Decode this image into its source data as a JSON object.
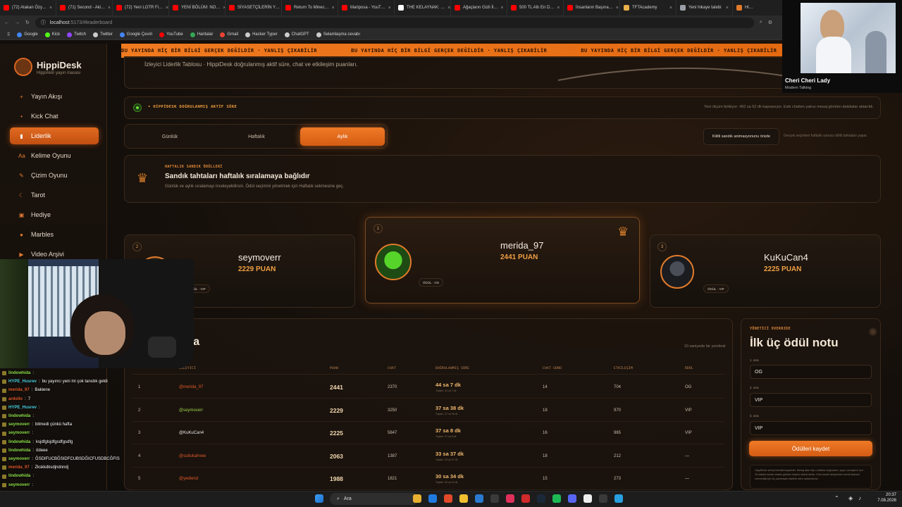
{
  "browser": {
    "tabs": [
      {
        "label": "(72) Atakan Özy…",
        "color": "#ff0000"
      },
      {
        "label": "(71) Second - Aki…",
        "color": "#ff0000"
      },
      {
        "label": "(72) Yeni LOTR Fi…",
        "color": "#ff0000"
      },
      {
        "label": "YENİ BÖLÜM: NO…",
        "color": "#ff0000"
      },
      {
        "label": "SİYASETÇİLERİN Y…",
        "color": "#ff0000"
      },
      {
        "label": "Return To Minec…",
        "color": "#ff0000"
      },
      {
        "label": "Mariposa - YouT…",
        "color": "#ff0000"
      },
      {
        "label": "THE KELAYNAK: …",
        "color": "#ffffff"
      },
      {
        "label": "Ağaçların Gizli İl…",
        "color": "#ff0000"
      },
      {
        "label": "500 TL Altı En D…",
        "color": "#ff0000"
      },
      {
        "label": "İnsanların Başına…",
        "color": "#ff0000"
      },
      {
        "label": "TFTAcademy",
        "color": "#e9b04a"
      },
      {
        "label": "Yeni hikaye talebi",
        "color": "#9aa0a6"
      },
      {
        "label": "Hi…",
        "color": "#e07a2a"
      }
    ],
    "url_host": "localhost",
    "url_path": ":5173/#leaderboard",
    "bookmarks": [
      {
        "label": "Google",
        "color": "#4285f4"
      },
      {
        "label": "Kick",
        "color": "#53fc18"
      },
      {
        "label": "Twitch",
        "color": "#9146ff"
      },
      {
        "label": "Twitter",
        "color": "#cccccc"
      },
      {
        "label": "Google Çeviri",
        "color": "#4285f4"
      },
      {
        "label": "YouTube",
        "color": "#ff0000"
      },
      {
        "label": "Haritalar",
        "color": "#34a853"
      },
      {
        "label": "Gmail",
        "color": "#ea4335"
      },
      {
        "label": "Hacker Typer",
        "color": "#cccccc"
      },
      {
        "label": "ChatGPT",
        "color": "#cccccc"
      },
      {
        "label": "Selamlaşma cevabı",
        "color": "#cccccc"
      }
    ]
  },
  "app": {
    "name": "HippiDesk",
    "subtitle": "HippiAkin yayın masası",
    "nav": [
      {
        "label": "Yayın Akışı",
        "icon": "plus-icon"
      },
      {
        "label": "Kick Chat",
        "icon": "chat-icon"
      },
      {
        "label": "Liderlik",
        "icon": "bars-icon"
      },
      {
        "label": "Kelime Oyunu",
        "icon": "text-icon"
      },
      {
        "label": "Çizim Oyunu",
        "icon": "brush-icon"
      },
      {
        "label": "Tarot",
        "icon": "card-icon"
      },
      {
        "label": "Hediye",
        "icon": "gift-icon"
      },
      {
        "label": "Marbles",
        "icon": "dot-icon"
      },
      {
        "label": "Video Arşivi",
        "icon": "video-icon"
      },
      {
        "label": "Ayarlar",
        "icon": "gear-icon"
      }
    ],
    "active_nav": "Liderlik",
    "ticker": [
      "BU YAYINDA HİÇ BİR BİLGİ GERÇEK DEĞİLDİR · YANLIŞ ÇIKABİLİR",
      "BU YAYINDA HİÇ BİR BİLGİ GERÇEK DEĞİLDİR · YANLIŞ ÇIKABİLİR",
      "BU YAYINDA HİÇ BİR BİLGİ GERÇEK DEĞİLDİR · YANLIŞ ÇIKABİLİR"
    ],
    "intro": "İzleyici Liderlik Tablosu · HippiDesk doğrulanmış aktif süre, chat ve etkileşim puanları.",
    "status_label": "• HİPPİDESK DOĞRULANMIŞ AKTİF SÜRE",
    "status_note": "Yeni ölçüm birikiyor: 492 sa 52 dk kapsanıyor. Eski chatten yalnız mesaj görülen dakikalar aktarıldı.",
    "period_tabs": [
      "Günlük",
      "Haftalık",
      "Aylık"
    ],
    "active_tab": "Aylık",
    "preview_button": "Kilitli sandık animasyonunu önizle",
    "preview_note": "Gerçek seçimleri haftalık sunucu kilitli tahtadan yapar.",
    "chest": {
      "kicker": "HAFTALIK SANDIK ÖDÜLLERİ",
      "title": "Sandık tahtaları haftalık sıralamaya bağlıdır",
      "subtitle": "Günlük ve aylık sıralamayı inceleyebilirsin. Ödül seçimini yönetmek için Haftalık sekmesine geç."
    },
    "podium": [
      {
        "rank": "1",
        "name": "merida_97",
        "points": "2441 PUAN",
        "reward": "ÖDÜL · OG"
      },
      {
        "rank": "2",
        "name": "seymoverr",
        "points": "2229 PUAN",
        "reward": "ÖDÜL · VIP"
      },
      {
        "rank": "3",
        "name": "KuKuCan4",
        "points": "2225 PUAN",
        "reward": "ÖDÜL · VIP"
      }
    ],
    "table": {
      "title_visible": "ma",
      "note": "10 saniyede bir yenilenir",
      "headers": [
        "İZLEYİCİ",
        "PUAN",
        "CHAT",
        "DOĞRULANMIŞ SÜRE",
        "CHAT GÜNÜ",
        "ETKİLEŞİM",
        "ÖDÜL"
      ],
      "rows": [
        {
          "rank": "1",
          "user": "@merida_97",
          "color": "#e05a2a",
          "points": "2441",
          "chat": "2370",
          "dur": "44 sa 7 dk",
          "dursub": "Toplam: 44 sa 7 dk",
          "days": "14",
          "eng": "704",
          "reward": "OG"
        },
        {
          "rank": "2",
          "user": "@seymoverr",
          "color": "#9ad44a",
          "points": "2229",
          "chat": "3250",
          "dur": "37 sa 38 dk",
          "dursub": "Toplam: 37 sa 38 dk",
          "days": "18",
          "eng": "970",
          "reward": "VIP"
        },
        {
          "rank": "3",
          "user": "@KuKuCan4",
          "color": "#e8e8e8",
          "points": "2225",
          "chat": "5847",
          "dur": "37 sa 8 dk",
          "dursub": "Toplam: 37 sa 8 dk",
          "days": "16",
          "eng": "965",
          "reward": "VIP"
        },
        {
          "rank": "4",
          "user": "@sutlukahvee",
          "color": "#e05a2a",
          "points": "2063",
          "chat": "1387",
          "dur": "33 sa 37 dk",
          "dursub": "Toplam: 33 sa 37 dk",
          "days": "18",
          "eng": "212",
          "reward": "—"
        },
        {
          "rank": "5",
          "user": "@yediend",
          "color": "#e05a2a",
          "points": "1988",
          "chat": "1821",
          "dur": "30 sa 34 dk",
          "dursub": "Toplam: 30 sa 34 dk",
          "days": "15",
          "eng": "273",
          "reward": "—"
        }
      ]
    },
    "admin": {
      "kicker": "YÖNETİCİ OVERRIDE",
      "title": "İlk üç ödül notu",
      "fields": [
        {
          "label": "1. sıra",
          "value": "OG"
        },
        {
          "label": "2. sıra",
          "value": "VIP"
        },
        {
          "label": "3. sıra",
          "value": "VIP"
        }
      ],
      "save": "Ödülleri kaydet",
      "note": "HippiDesk süreyi kendisi kaydeder. Mesaj atan kişi o dakika doğrulanır; yayın canlıyken son 15 dakika içinde chatte görülen kişinin süresi ilerler. Kick kanalı izleyicilerin kendi listesini vermediği için hiç yazmayan kişilere süre uydurulmaz."
    }
  },
  "media": {
    "title": "Cheri Cheri Lady",
    "subtitle": "Modern Talking"
  },
  "chat": [
    {
      "user": "lindowhida",
      "color": "#8ee04a",
      "msg": ""
    },
    {
      "user": "HYPE_Husrev",
      "color": "#4ad0e0",
      "msg": "bu yayıncı yeni mi çok tanıdık geldi"
    },
    {
      "user": "merida_97",
      "color": "#e05a2a",
      "msg": "Bakiene"
    },
    {
      "user": "ardollo",
      "color": "#e05a2a",
      "msg": "7"
    },
    {
      "user": "HYPE_Husrev",
      "color": "#4ad0e0",
      "msg": ""
    },
    {
      "user": "lindowhida",
      "color": "#8ee04a",
      "msg": ""
    },
    {
      "user": "seymoverr",
      "color": "#8ee04a",
      "msg": "bitmedi çünkü hafta"
    },
    {
      "user": "seymoverr",
      "color": "#8ee04a",
      "msg": ""
    },
    {
      "user": "lindowhida",
      "color": "#8ee04a",
      "msg": "ksjdfglsjdfgsdfgsdfg"
    },
    {
      "user": "lindowhida",
      "color": "#8ee04a",
      "msg": "ödeee"
    },
    {
      "user": "seymoverr",
      "color": "#8ee04a",
      "msg": "ĞSDIFUCBĞSIDFCUBSDĞICFUSDBCĞFIS"
    },
    {
      "user": "merida_97",
      "color": "#e05a2a",
      "msg": "Zkskkdksdjndnndj"
    },
    {
      "user": "lindowhida",
      "color": "#8ee04a",
      "msg": ""
    },
    {
      "user": "seymoverr",
      "color": "#8ee04a",
      "msg": ""
    }
  ],
  "taskbar": {
    "search": "Ara",
    "time": "20:37",
    "date": "7.08.2026"
  }
}
